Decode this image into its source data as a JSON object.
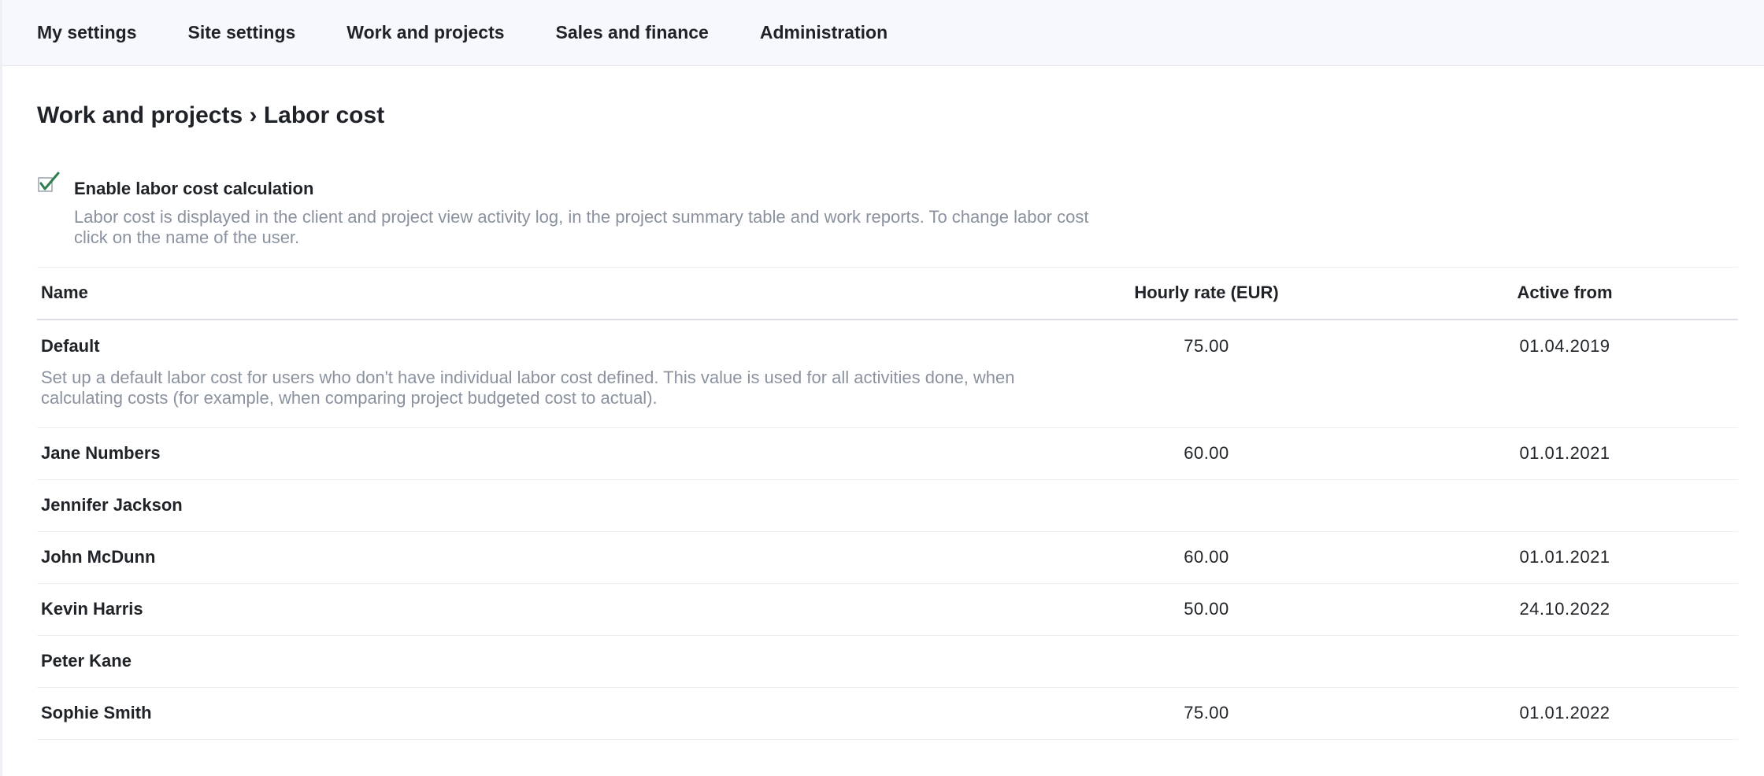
{
  "nav": {
    "items": [
      {
        "label": "My settings"
      },
      {
        "label": "Site settings"
      },
      {
        "label": "Work and projects"
      },
      {
        "label": "Sales and finance"
      },
      {
        "label": "Administration"
      }
    ]
  },
  "page": {
    "title": "Work and projects › Labor cost"
  },
  "setting": {
    "label": "Enable labor cost calculation",
    "checked": true,
    "description": "Labor cost is displayed in the client and project view activity log, in the project summary table and work reports. To change labor cost click on the name of the user.",
    "check_color": "#2e7d4f"
  },
  "table": {
    "headers": {
      "name": "Name",
      "rate": "Hourly rate (EUR)",
      "active_from": "Active from"
    },
    "default_row": {
      "name": "Default",
      "description": "Set up a default labor cost for users who don't have individual labor cost defined. This value is used for all activities done, when calculating costs (for example, when comparing project budgeted cost to actual).",
      "rate": "75.00",
      "active_from": "01.04.2019"
    },
    "rows": [
      {
        "name": "Jane Numbers",
        "rate": "60.00",
        "active_from": "01.01.2021"
      },
      {
        "name": "Jennifer Jackson",
        "rate": "",
        "active_from": ""
      },
      {
        "name": "John McDunn",
        "rate": "60.00",
        "active_from": "01.01.2021"
      },
      {
        "name": "Kevin Harris",
        "rate": "50.00",
        "active_from": "24.10.2022"
      },
      {
        "name": "Peter Kane",
        "rate": "",
        "active_from": ""
      },
      {
        "name": "Sophie Smith",
        "rate": "75.00",
        "active_from": "01.01.2022"
      }
    ]
  }
}
